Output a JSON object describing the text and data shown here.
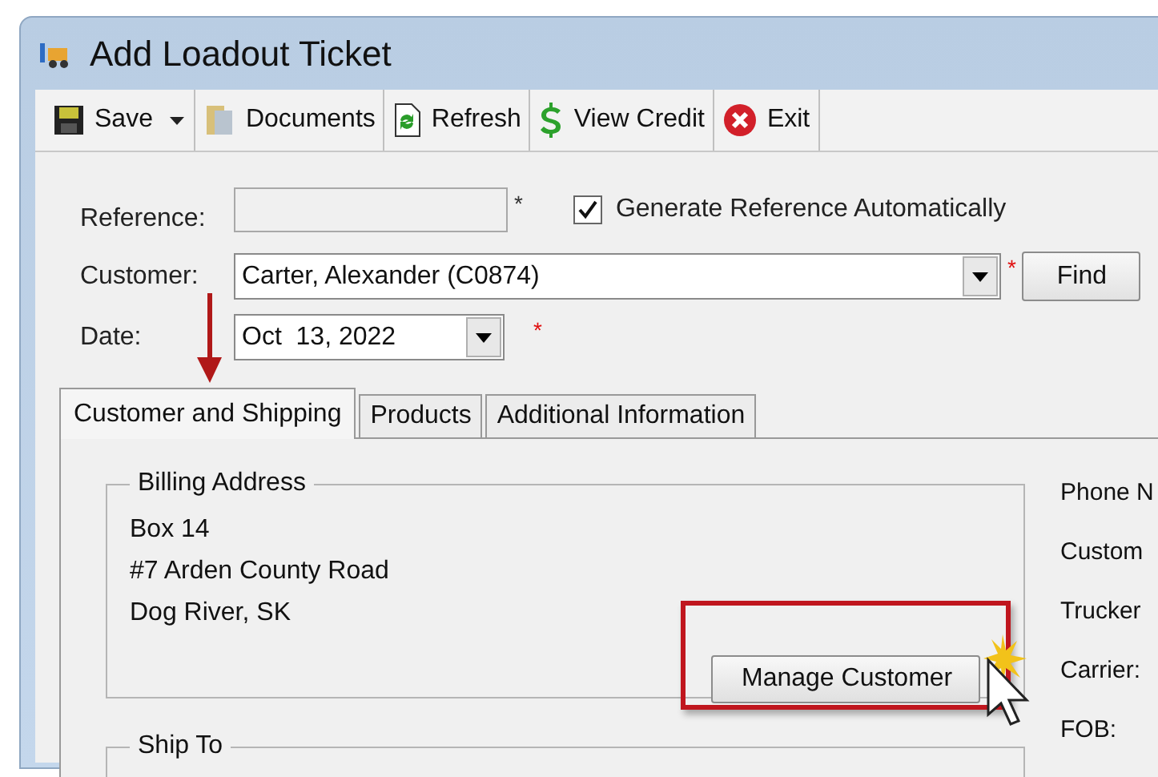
{
  "window": {
    "title": "Add Loadout Ticket"
  },
  "toolbar": [
    {
      "kind": "save",
      "label": "Save",
      "dropdown": true
    },
    {
      "kind": "documents",
      "label": "Documents",
      "dropdown": false
    },
    {
      "kind": "refresh",
      "label": "Refresh",
      "dropdown": false
    },
    {
      "kind": "credit",
      "label": "View Credit",
      "dropdown": false
    },
    {
      "kind": "exit",
      "label": "Exit",
      "dropdown": false
    }
  ],
  "reference": {
    "label": "Reference:",
    "required_mark": "*"
  },
  "generate_reference": {
    "label": "Generate Reference Automatically",
    "checked": true
  },
  "customer": {
    "label": "Customer:",
    "value": "Carter, Alexander (C0874)",
    "required_mark": "*",
    "find_button": "Find"
  },
  "date": {
    "label": "Date:",
    "value": "Oct  13, 2022",
    "required_mark": "*"
  },
  "tabs": [
    {
      "label": "Customer and Shipping",
      "selected": true
    },
    {
      "label": "Products",
      "selected": false
    },
    {
      "label": "Additional Information",
      "selected": false
    }
  ],
  "billing_address": {
    "title": "Billing Address",
    "lines": [
      "Box 14",
      "#7 Arden County Road",
      "Dog River, SK"
    ],
    "button": "Manage Customer"
  },
  "ship_to": {
    "title": "Ship To"
  },
  "side_labels": [
    "Phone N",
    "Custom",
    "Trucker",
    "Carrier:",
    "FOB:"
  ]
}
